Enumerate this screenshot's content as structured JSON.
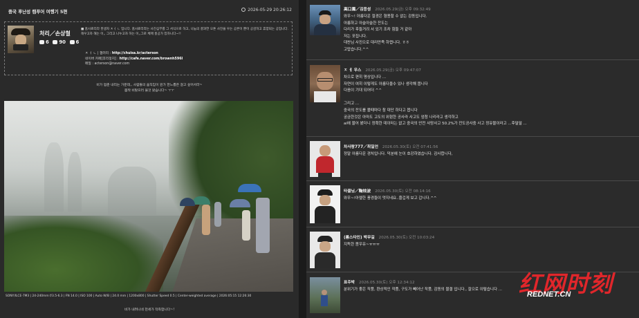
{
  "post": {
    "title": "중국 후난성 캠푸어 여행기 5편",
    "date": "2026-05-29 20:26:12"
  },
  "author": {
    "name": "처리／손상철",
    "comments": "6",
    "views": "90",
    "likes": "6",
    "intro": "■ 홈사료리라 붓생자 ㅈㅓ ㄴ 입니다. 홈사료리라는 사진심부를 그 서식으로 하고, 나눔의 결과한 오톤 사진을 우는 공론이 뿐이 공감하고 휴양되는 공입니다. 해우고자 해는 이,, 그리고 나누고자 하는 이,,그로 체매 홍공가 있하니다~!!",
    "line1": "ㅈ ㅓ ㄴ | 갤러리 : ",
    "gallery": "http://chuisa.kr/acterson",
    "line2": "네이버 카페[후리정지] : ",
    "cafe": "http://cafe.naver.com/brownh596l",
    "line3": "메일 : acterson@naver.com"
  },
  "caption_top_1": "비가 멈춘 내리는 가운데,, 사람들의 움직임이 뭔가 한느롭은 걸고 싶어서라~",
  "caption_top_2": "몸짝 비탈으러 물것 왔습니다~ ㅜㅜ",
  "photo_meta": "SONY/ILCE-7M3 | 24-240mm f/3.5-6.3 | FN 14.0 | ISO 100 | Auto W/B | 24.0 mm | 1200x800 | Shutter Speed 0.5 | Center-weighted average | 2026:05:15 12:26:30",
  "caption_bottom": "비가 내려니네 천세가 작측합니다~!",
  "comments": [
    {
      "name": "高口鳳／김응성",
      "date": "2026.05.29(금) 오후 09:32:49",
      "body": "와우~! 아름다운 절경은 형용할 수 없는 감동입니다.\n아름하고 아슬아슬한 잔도는\n다리가 후들거려 서 있기 조차 힘들 거 같아\n저는 포집니다.\n대찬님 사진으로 대리만족 하렵니다. ㅎㅎ\n고맙습니다.^^"
    },
    {
      "name": "ㅈ ㅔ 우스",
      "date": "2026.05.29(금) 오후 09:47:07",
      "body": "차으로 편히 명상입니다 ...\n자연이 여히 이렇게도 아름다울수 있나 생각해 봅니다\n다음이 기대 되어더 ^^\n\n그리고 ...\n중국의 잔도를 볼때마다 참 대단 하다고 봅니다\n궁금한것은 아마도 고도의 위험한 공사라 사고도 엄청 나리라고 생각하고\nai에 물어 봤더니 정확한 데이터는 없고 중국의 안전 사망사고 50.2%가 잔도공사중 사고 정유물이라고 ...후덜덜 ..."
    },
    {
      "name": "차사랑777／최일언",
      "date": "2026.05.30(토) 오전 07:41:56",
      "body": "정말 아름다운 경치입니다. 덕분에 눈이 호강하였습니다. 감사합니다,"
    },
    {
      "name": "타클님／鞠炫波",
      "date": "2026.05.30(토) 오전 08:14:16",
      "body": "와우~!아렐한 풍경들이 멋지네요..즐겁게 보고 갑니다.^^"
    },
    {
      "name": "(롬스타인) 박무길",
      "date": "2026.05.30(토) 오전 10:03:24",
      "body": "지독한 봄우유~ㅠㅠㅠ"
    },
    {
      "name": "표주박",
      "date": "2026.05.30(토) 오후 12:34:12",
      "body": "분위기가 좋은 작품, 환상적인 작품, 구도가 빼어난 작품, 감동의 물결 입니다., 잘으로 이렇습니다 ..."
    }
  ],
  "watermark": {
    "logo": "红网时刻",
    "url": "REDNET.CN",
    "color": "#e0262b"
  }
}
